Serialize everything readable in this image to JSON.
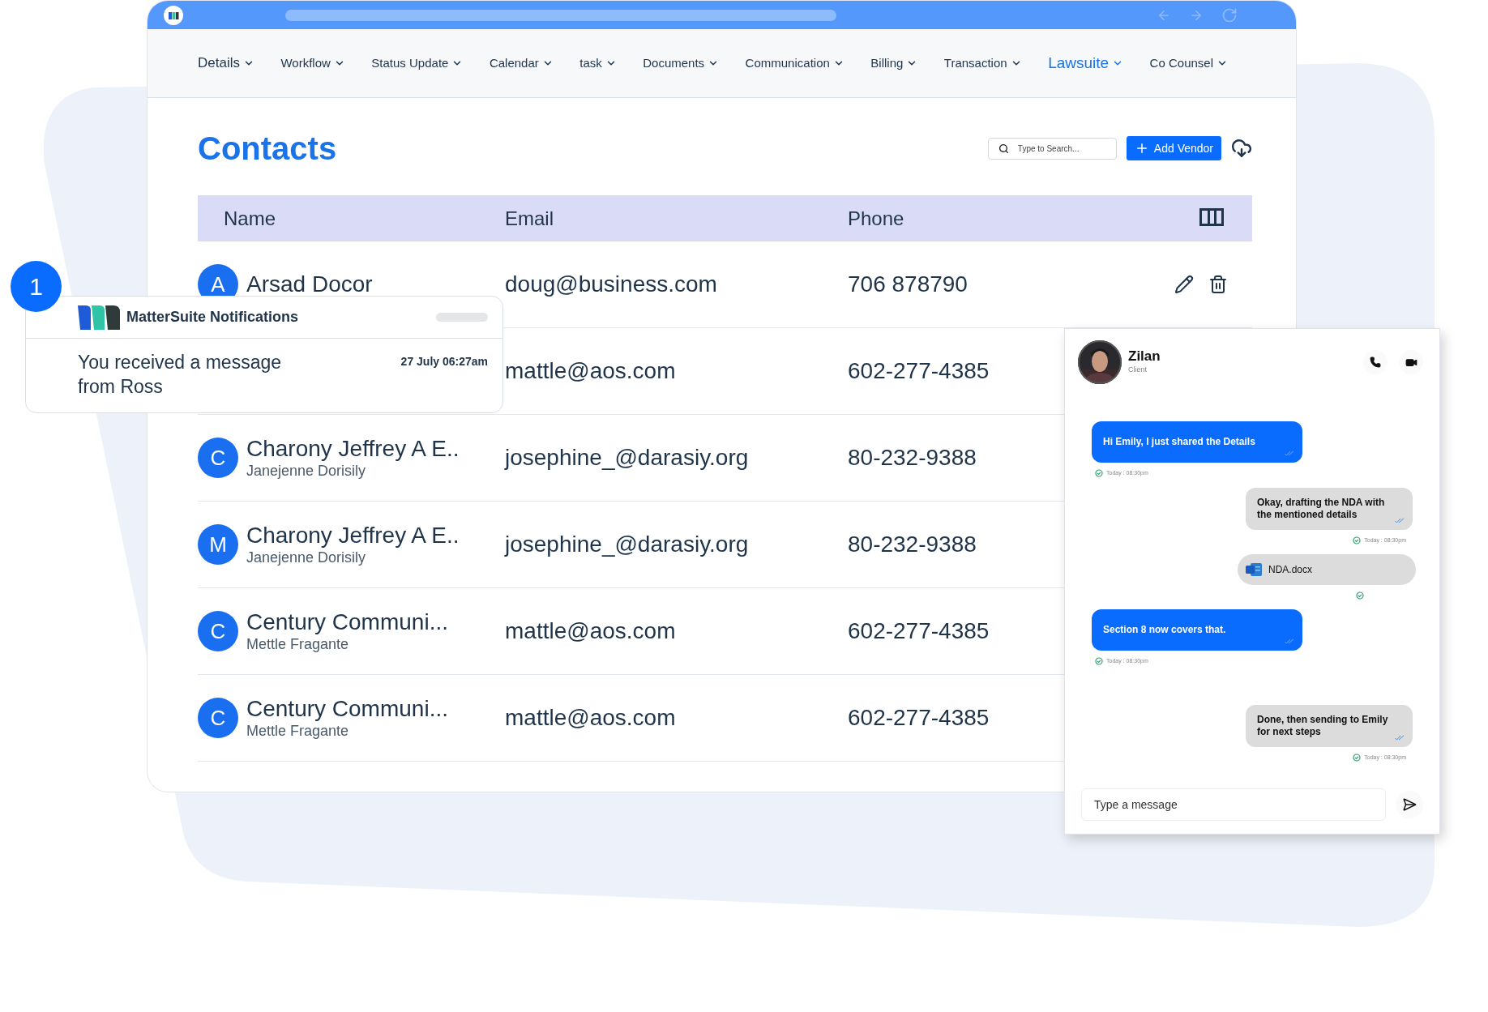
{
  "nav": [
    {
      "label": "Details",
      "selected": false
    },
    {
      "label": "Workflow",
      "selected": false
    },
    {
      "label": "Status Update",
      "selected": false
    },
    {
      "label": "Calendar",
      "selected": false
    },
    {
      "label": "task",
      "selected": false
    },
    {
      "label": "Documents",
      "selected": false
    },
    {
      "label": "Communication",
      "selected": false
    },
    {
      "label": "Billing",
      "selected": false
    },
    {
      "label": "Transaction",
      "selected": false
    },
    {
      "label": "Lawsuite",
      "selected": true
    },
    {
      "label": "Co Counsel",
      "selected": false
    }
  ],
  "page": {
    "title": "Contacts",
    "search": {
      "placeholder": "Type to Search..."
    },
    "add_button": "Add Vendor"
  },
  "table": {
    "columns": [
      "Name",
      "Email",
      "Phone"
    ],
    "rows": [
      {
        "avatar": "A",
        "name": "Arsad Docor",
        "email": "doug@business.com",
        "phone": "706 878790",
        "actions": true
      },
      {
        "email": "mattle@aos.com",
        "phone": "602-277-4385",
        "actions": false
      },
      {
        "avatar": "C",
        "name": "Charony Jeffrey A E..",
        "subtitle": "Janejenne Dorisily",
        "email": "josephine_@darasiy.org",
        "phone": "80-232-9388",
        "actions": false
      },
      {
        "avatar": "M",
        "name": "Charony Jeffrey A E..",
        "subtitle": "Janejenne Dorisily",
        "email": "josephine_@darasiy.org",
        "phone": "80-232-9388",
        "actions": false
      },
      {
        "avatar": "C",
        "name": "Century Communi...",
        "subtitle": "Mettle Fragante",
        "email": "mattle@aos.com",
        "phone": "602-277-4385",
        "actions": false
      },
      {
        "avatar": "C",
        "name": "Century Communi...",
        "subtitle": "Mettle Fragante",
        "email": "mattle@aos.com",
        "phone": "602-277-4385",
        "actions": false
      }
    ]
  },
  "notification": {
    "badge": "1",
    "app": "MatterSuite Notifications",
    "message": "You received a message from Ross",
    "time": "27 July 06:27am"
  },
  "chat": {
    "name": "Zilan",
    "role": "Client",
    "messages": [
      {
        "kind": "text",
        "outgoing": false,
        "text": "Hi Emily, I just shared the Details",
        "time": "Today : 08:30pm"
      },
      {
        "kind": "text",
        "outgoing": true,
        "text": "Okay, drafting the NDA with the mentioned details",
        "time": "Today : 08:30pm"
      },
      {
        "kind": "file",
        "outgoing": true,
        "text": "NDA.docx"
      },
      {
        "kind": "text",
        "outgoing": false,
        "text": "Section 8 now covers that.",
        "time": "Today : 08:30pm"
      },
      {
        "kind": "text",
        "outgoing": true,
        "text": "Done, then sending to Emily for next steps",
        "time": "Today : 08:30pm"
      }
    ],
    "input": {
      "placeholder": "Type a message"
    }
  }
}
